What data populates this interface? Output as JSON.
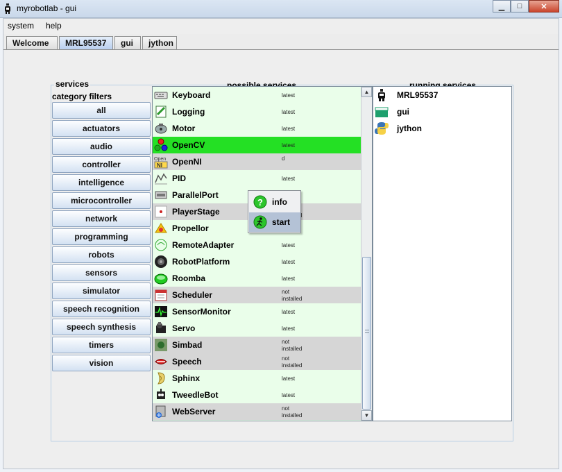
{
  "window": {
    "title": "myrobotlab - gui",
    "minimize": "▁",
    "maximize": "□",
    "close": "✕"
  },
  "menu": [
    "system",
    "help"
  ],
  "tabs": [
    {
      "label": "Welcome",
      "active": false
    },
    {
      "label": "MRL95537",
      "active": true
    },
    {
      "label": "gui",
      "active": false
    },
    {
      "label": "jython",
      "active": false
    }
  ],
  "services_panel": {
    "legend": "services"
  },
  "category_filters": {
    "title": "category filters",
    "items": [
      "all",
      "actuators",
      "audio",
      "controller",
      "intelligence",
      "microcontroller",
      "network",
      "programming",
      "robots",
      "sensors",
      "simulator",
      "speech recognition",
      "speech synthesis",
      "timers",
      "vision"
    ]
  },
  "possible_services": {
    "title": "possible services",
    "items": [
      {
        "name": "Keyboard",
        "status": [
          "latest"
        ],
        "state": "installed",
        "icon": "keyboard-icon"
      },
      {
        "name": "Logging",
        "status": [
          "latest"
        ],
        "state": "installed",
        "icon": "logging-icon"
      },
      {
        "name": "Motor",
        "status": [
          "latest"
        ],
        "state": "installed",
        "icon": "motor-icon"
      },
      {
        "name": "OpenCV",
        "status": [
          "latest"
        ],
        "state": "selected",
        "icon": "opencv-icon"
      },
      {
        "name": "OpenNI",
        "status": [
          "",
          "d"
        ],
        "state": "not",
        "icon": "openni-icon"
      },
      {
        "name": "PID",
        "status": [
          "latest"
        ],
        "state": "installed",
        "icon": "pid-icon"
      },
      {
        "name": "ParallelPort",
        "status": [
          "latest"
        ],
        "state": "installed",
        "icon": "parallelport-icon"
      },
      {
        "name": "PlayerStage",
        "status": [
          "not",
          "installed"
        ],
        "state": "not",
        "icon": "playerstage-icon"
      },
      {
        "name": "Propellor",
        "status": [
          "latest"
        ],
        "state": "installed",
        "icon": "propellor-icon"
      },
      {
        "name": "RemoteAdapter",
        "status": [
          "latest"
        ],
        "state": "installed",
        "icon": "remoteadapter-icon"
      },
      {
        "name": "RobotPlatform",
        "status": [
          "latest"
        ],
        "state": "installed",
        "icon": "robotplatform-icon"
      },
      {
        "name": "Roomba",
        "status": [
          "latest"
        ],
        "state": "installed",
        "icon": "roomba-icon"
      },
      {
        "name": "Scheduler",
        "status": [
          "not",
          "installed"
        ],
        "state": "not",
        "icon": "scheduler-icon"
      },
      {
        "name": "SensorMonitor",
        "status": [
          "latest"
        ],
        "state": "installed",
        "icon": "sensormonitor-icon"
      },
      {
        "name": "Servo",
        "status": [
          "latest"
        ],
        "state": "installed",
        "icon": "servo-icon"
      },
      {
        "name": "Simbad",
        "status": [
          "not",
          "installed"
        ],
        "state": "not",
        "icon": "simbad-icon"
      },
      {
        "name": "Speech",
        "status": [
          "not",
          "installed"
        ],
        "state": "not",
        "icon": "speech-icon"
      },
      {
        "name": "Sphinx",
        "status": [
          "latest"
        ],
        "state": "installed",
        "icon": "sphinx-icon"
      },
      {
        "name": "TweedleBot",
        "status": [
          "latest"
        ],
        "state": "installed",
        "icon": "tweedlebot-icon"
      },
      {
        "name": "WebServer",
        "status": [
          "not",
          "installed"
        ],
        "state": "not",
        "icon": "webserver-icon"
      }
    ]
  },
  "running_services": {
    "title": "running services",
    "items": [
      {
        "name": "MRL95537",
        "icon": "mrl-robot-icon"
      },
      {
        "name": "gui",
        "icon": "gui-icon"
      },
      {
        "name": "jython",
        "icon": "python-icon"
      }
    ]
  },
  "context_menu": {
    "items": [
      {
        "label": "info",
        "icon": "info-question-icon",
        "highlighted": false
      },
      {
        "label": "start",
        "icon": "start-runner-icon",
        "highlighted": true
      }
    ]
  },
  "colors": {
    "selected_row": "#24e024",
    "installed_row": "#eafeea",
    "not_installed_row": "#d6d6d6",
    "button_gradient_bottom": "#d3e1f2"
  }
}
